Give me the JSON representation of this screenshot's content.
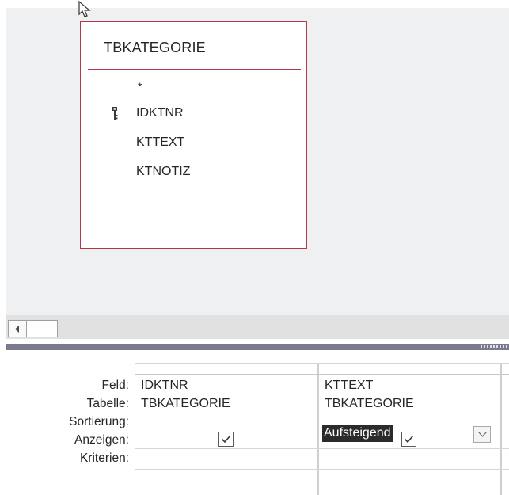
{
  "table_window": {
    "title": "TBKATEGORIE",
    "fields": [
      {
        "label": "*",
        "is_key": false
      },
      {
        "label": "IDKTNR",
        "is_key": true,
        "icon": "primary-key-icon"
      },
      {
        "label": "KTTEXT",
        "is_key": false
      },
      {
        "label": "KTNOTIZ",
        "is_key": false
      }
    ],
    "border_color": "#b2374a"
  },
  "design_grid": {
    "row_labels": {
      "field": "Feld:",
      "table": "Tabelle:",
      "sort": "Sortierung:",
      "show": "Anzeigen:",
      "criteria": "Kriterien:"
    },
    "columns": [
      {
        "field": "IDKTNR",
        "table": "TBKATEGORIE",
        "sort": "",
        "show": true,
        "criteria": ""
      },
      {
        "field": "KTTEXT",
        "table": "TBKATEGORIE",
        "sort": "Aufsteigend",
        "show": true,
        "criteria": ""
      }
    ]
  },
  "icons": {
    "cursor": "pointer-cursor-icon",
    "scroll_left": "scroll-left-arrow-icon",
    "dropdown": "chevron-down-icon",
    "checkbox": "checkmark-icon"
  },
  "colors": {
    "canvas_bg": "#eff0f1",
    "splitter": "#7a7c8e",
    "selection_bg": "#2b2b2b"
  }
}
